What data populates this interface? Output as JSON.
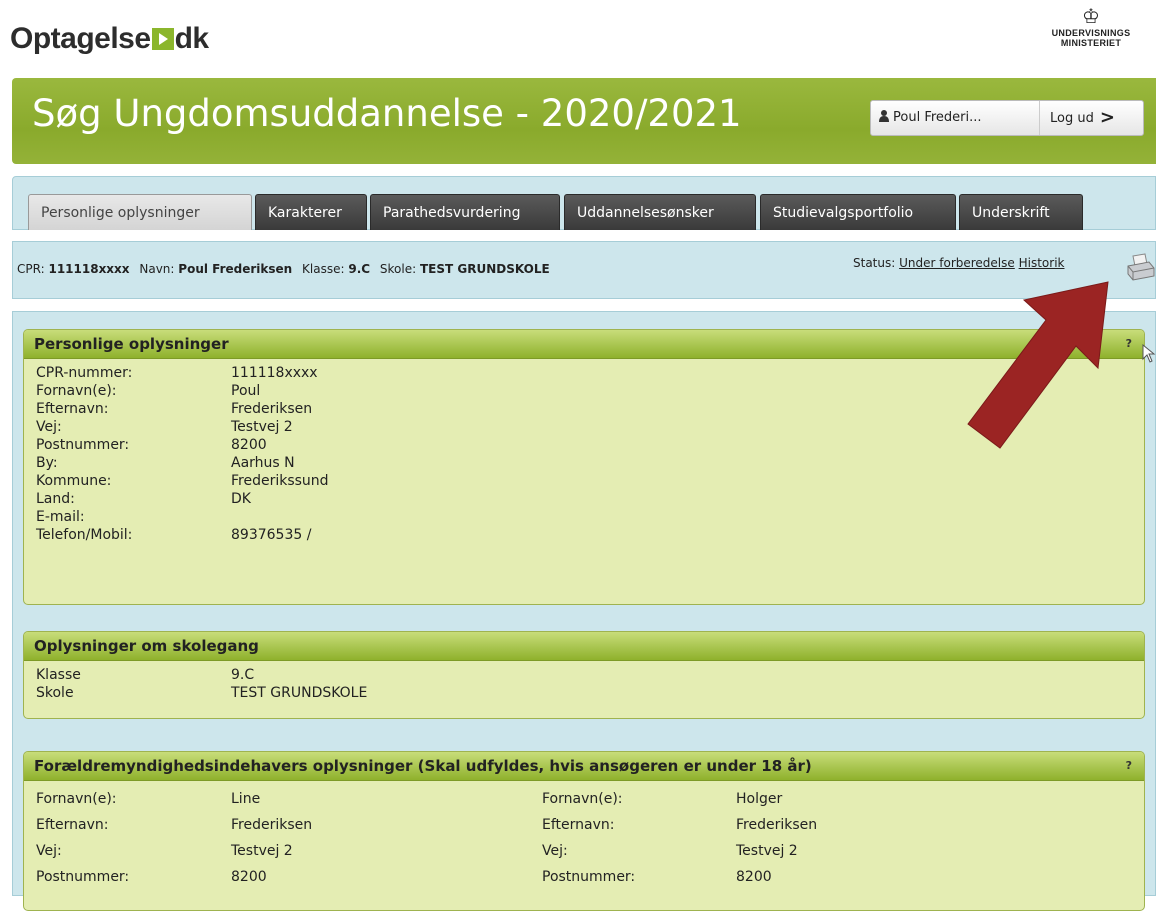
{
  "brand": {
    "logo_left": "Optagelse",
    "logo_right": "dk",
    "ministry_line1": "UNDERVISNINGS",
    "ministry_line2": "MINISTERIET"
  },
  "header": {
    "title": "Søg Ungdomsuddannelse - 2020/2021",
    "user_name": "Poul Frederi...",
    "logout_label": "Log ud"
  },
  "tabs": [
    {
      "label": "Personlige oplysninger",
      "active": true
    },
    {
      "label": "Karakterer"
    },
    {
      "label": "Parathedsvurdering"
    },
    {
      "label": "Uddannelsesønsker"
    },
    {
      "label": "Studievalgsportfolio"
    },
    {
      "label": "Underskrift"
    }
  ],
  "infobar": {
    "cpr_label": "CPR:",
    "cpr_value": "111118xxxx",
    "name_label": "Navn:",
    "name_value": "Poul Frederiksen",
    "class_label": "Klasse:",
    "class_value": "9.C",
    "school_label": "Skole:",
    "school_value": "TEST GRUNDSKOLE",
    "status_label": "Status:",
    "status_value": "Under forberedelse",
    "history_label": "Historik"
  },
  "personal": {
    "title": "Personlige oplysninger",
    "help": "?",
    "rows": [
      {
        "label": "CPR-nummer:",
        "value": "111118xxxx"
      },
      {
        "label": "Fornavn(e):",
        "value": "Poul"
      },
      {
        "label": "Efternavn:",
        "value": "Frederiksen"
      },
      {
        "label": "Vej:",
        "value": "Testvej 2"
      },
      {
        "label": "Postnummer:",
        "value": "8200"
      },
      {
        "label": "By:",
        "value": "Aarhus N"
      },
      {
        "label": "Kommune:",
        "value": "Frederikssund"
      },
      {
        "label": "Land:",
        "value": "DK"
      },
      {
        "label": "E-mail:",
        "value": ""
      },
      {
        "label": "Telefon/Mobil:",
        "value": "89376535 /"
      }
    ]
  },
  "school": {
    "title": "Oplysninger om skolegang",
    "rows": [
      {
        "label": "Klasse",
        "value": "9.C"
      },
      {
        "label": "Skole",
        "value": "TEST GRUNDSKOLE"
      }
    ]
  },
  "guardians": {
    "title": "Forældremyndighedsindehavers oplysninger (Skal udfyldes, hvis ansøgeren er under 18 år)",
    "help": "?",
    "rows": [
      {
        "label": "Fornavn(e):",
        "value": "Line",
        "label2": "Fornavn(e):",
        "value2": "Holger"
      },
      {
        "label": "Efternavn:",
        "value": "Frederiksen",
        "label2": "Efternavn:",
        "value2": "Frederiksen"
      },
      {
        "label": "Vej:",
        "value": "Testvej 2",
        "label2": "Vej:",
        "value2": "Testvej 2"
      },
      {
        "label": "Postnummer:",
        "value": "8200",
        "label2": "Postnummer:",
        "value2": "8200"
      }
    ]
  },
  "colors": {
    "header_green": "#8aaa2c",
    "panel_bg": "#e4edb3",
    "band_blue": "#cde6ec",
    "tab_dark": "#3a3a3a",
    "arrow_red": "#9b2423"
  }
}
